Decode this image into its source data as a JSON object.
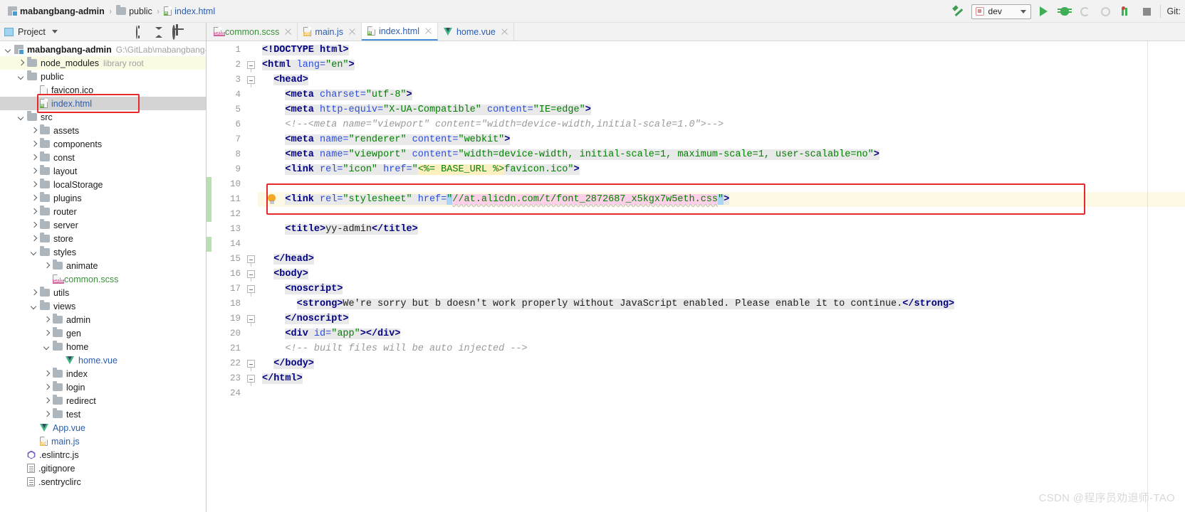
{
  "window": {
    "watermark": "CSDN @程序员劝退师-TAO"
  },
  "breadcrumb": {
    "items": [
      {
        "label": "mabangbang-admin",
        "icon": "module-icon",
        "type": "root"
      },
      {
        "label": "public",
        "icon": "folder-icon",
        "type": "folder"
      },
      {
        "label": "index.html",
        "icon": "html-file-icon",
        "type": "file"
      }
    ],
    "separator": "›"
  },
  "toolbar": {
    "build_icon": "hammer-icon",
    "run_config": {
      "label": "dev",
      "icon": "run-config-icon",
      "caret": "chevron-down-icon"
    },
    "run_icon": "run-play-icon",
    "debug_icon": "debug-bug-icon",
    "run_with_coverage_icon": "run-with-coverage-icon",
    "profile_icon": "profile-icon",
    "attach_icon": "attach-debugger-icon",
    "stop_icon": "stop-icon",
    "git_label": "Git:"
  },
  "project_panel": {
    "title": "Project",
    "title_caret": "chevron-down-icon",
    "actions": [
      {
        "name": "locate-icon"
      },
      {
        "name": "collapse-all-icon"
      },
      {
        "name": "settings-gear-icon"
      },
      {
        "name": "hide-panel-icon"
      }
    ],
    "tree": [
      {
        "depth": 0,
        "arrow": "down",
        "icon": "module",
        "label": "mabangbang-admin",
        "style": "bold",
        "note": "G:\\GitLab\\mabangbang-ad",
        "state": "normal"
      },
      {
        "depth": 1,
        "arrow": "right",
        "icon": "folder",
        "label": "node_modules",
        "style": "normal",
        "note": "library root",
        "state": "highlight"
      },
      {
        "depth": 1,
        "arrow": "down",
        "icon": "folder",
        "label": "public",
        "style": "normal",
        "note": "",
        "state": "normal"
      },
      {
        "depth": 2,
        "arrow": "none",
        "icon": "file-img",
        "label": "favicon.ico",
        "style": "normal",
        "note": "",
        "state": "normal"
      },
      {
        "depth": 2,
        "arrow": "none",
        "icon": "file-html",
        "label": "index.html",
        "style": "link",
        "note": "",
        "state": "selected"
      },
      {
        "depth": 1,
        "arrow": "down",
        "icon": "folder",
        "label": "src",
        "style": "normal",
        "note": "",
        "state": "normal"
      },
      {
        "depth": 2,
        "arrow": "right",
        "icon": "folder",
        "label": "assets",
        "style": "normal",
        "note": "",
        "state": "normal"
      },
      {
        "depth": 2,
        "arrow": "right",
        "icon": "folder",
        "label": "components",
        "style": "normal",
        "note": "",
        "state": "normal"
      },
      {
        "depth": 2,
        "arrow": "right",
        "icon": "folder",
        "label": "const",
        "style": "normal",
        "note": "",
        "state": "normal"
      },
      {
        "depth": 2,
        "arrow": "right",
        "icon": "folder",
        "label": "layout",
        "style": "normal",
        "note": "",
        "state": "normal"
      },
      {
        "depth": 2,
        "arrow": "right",
        "icon": "folder",
        "label": "localStorage",
        "style": "normal",
        "note": "",
        "state": "normal"
      },
      {
        "depth": 2,
        "arrow": "right",
        "icon": "folder",
        "label": "plugins",
        "style": "normal",
        "note": "",
        "state": "normal"
      },
      {
        "depth": 2,
        "arrow": "right",
        "icon": "folder",
        "label": "router",
        "style": "normal",
        "note": "",
        "state": "normal"
      },
      {
        "depth": 2,
        "arrow": "right",
        "icon": "folder",
        "label": "server",
        "style": "normal",
        "note": "",
        "state": "normal"
      },
      {
        "depth": 2,
        "arrow": "right",
        "icon": "folder",
        "label": "store",
        "style": "normal",
        "note": "",
        "state": "normal"
      },
      {
        "depth": 2,
        "arrow": "down",
        "icon": "folder",
        "label": "styles",
        "style": "normal",
        "note": "",
        "state": "normal"
      },
      {
        "depth": 3,
        "arrow": "right",
        "icon": "folder",
        "label": "animate",
        "style": "normal",
        "note": "",
        "state": "normal"
      },
      {
        "depth": 3,
        "arrow": "none",
        "icon": "file-sass",
        "label": "common.scss",
        "style": "scss",
        "note": "",
        "state": "normal"
      },
      {
        "depth": 2,
        "arrow": "right",
        "icon": "folder",
        "label": "utils",
        "style": "normal",
        "note": "",
        "state": "normal"
      },
      {
        "depth": 2,
        "arrow": "down",
        "icon": "folder",
        "label": "views",
        "style": "normal",
        "note": "",
        "state": "normal"
      },
      {
        "depth": 3,
        "arrow": "right",
        "icon": "folder",
        "label": "admin",
        "style": "normal",
        "note": "",
        "state": "normal"
      },
      {
        "depth": 3,
        "arrow": "right",
        "icon": "folder",
        "label": "gen",
        "style": "normal",
        "note": "",
        "state": "normal"
      },
      {
        "depth": 3,
        "arrow": "down",
        "icon": "folder",
        "label": "home",
        "style": "normal",
        "note": "",
        "state": "normal"
      },
      {
        "depth": 4,
        "arrow": "none",
        "icon": "file-vue",
        "label": "home.vue",
        "style": "vue",
        "note": "",
        "state": "normal"
      },
      {
        "depth": 3,
        "arrow": "right",
        "icon": "folder",
        "label": "index",
        "style": "normal",
        "note": "",
        "state": "normal"
      },
      {
        "depth": 3,
        "arrow": "right",
        "icon": "folder",
        "label": "login",
        "style": "normal",
        "note": "",
        "state": "normal"
      },
      {
        "depth": 3,
        "arrow": "right",
        "icon": "folder",
        "label": "redirect",
        "style": "normal",
        "note": "",
        "state": "normal"
      },
      {
        "depth": 3,
        "arrow": "right",
        "icon": "folder",
        "label": "test",
        "style": "normal",
        "note": "",
        "state": "normal"
      },
      {
        "depth": 2,
        "arrow": "none",
        "icon": "file-vue",
        "label": "App.vue",
        "style": "vue",
        "note": "",
        "state": "normal"
      },
      {
        "depth": 2,
        "arrow": "none",
        "icon": "file-js",
        "label": "main.js",
        "style": "link",
        "note": "",
        "state": "normal"
      },
      {
        "depth": 1,
        "arrow": "none",
        "icon": "file-eslint",
        "label": ".eslintrc.js",
        "style": "normal",
        "note": "",
        "state": "normal"
      },
      {
        "depth": 1,
        "arrow": "none",
        "icon": "file-plain",
        "label": ".gitignore",
        "style": "normal",
        "note": "",
        "state": "normal"
      },
      {
        "depth": 1,
        "arrow": "none",
        "icon": "file-plain",
        "label": ".sentryclirc",
        "style": "normal",
        "note": "",
        "state": "normal"
      }
    ]
  },
  "editor": {
    "tabs": [
      {
        "label": "common.scss",
        "icon": "sass-file-icon",
        "kind": "scss",
        "active": false,
        "close": "close-icon"
      },
      {
        "label": "main.js",
        "icon": "js-file-icon",
        "kind": "js",
        "active": false,
        "close": "close-icon"
      },
      {
        "label": "index.html",
        "icon": "html-file-icon",
        "kind": "html",
        "active": true,
        "close": "close-icon"
      },
      {
        "label": "home.vue",
        "icon": "vue-file-icon",
        "kind": "vue",
        "active": false,
        "close": "close-icon"
      }
    ],
    "line_numbers": [
      "1",
      "2",
      "3",
      "4",
      "5",
      "6",
      "7",
      "8",
      "9",
      "10",
      "11",
      "12",
      "13",
      "14",
      "15",
      "16",
      "17",
      "18",
      "19",
      "20",
      "21",
      "22",
      "23",
      "24"
    ],
    "highlighted_line": 11,
    "gutter_intention_icon": "lightbulb-icon",
    "annotation_color": "#e8292b",
    "code_lines": [
      {
        "n": 1,
        "indent": 0,
        "tokens": [
          {
            "t": "doctype",
            "v": "<!DOCTYPE html>"
          }
        ]
      },
      {
        "n": 2,
        "indent": 0,
        "tokens": [
          {
            "t": "tag",
            "v": "<html "
          },
          {
            "t": "attr",
            "v": "lang="
          },
          {
            "t": "val",
            "v": "\"en\""
          },
          {
            "t": "tag",
            "v": ">"
          }
        ]
      },
      {
        "n": 3,
        "indent": 1,
        "tokens": [
          {
            "t": "tag",
            "v": "<head>"
          }
        ]
      },
      {
        "n": 4,
        "indent": 2,
        "tokens": [
          {
            "t": "tag",
            "v": "<meta "
          },
          {
            "t": "attr",
            "v": "charset="
          },
          {
            "t": "val",
            "v": "\"utf-8\""
          },
          {
            "t": "tag",
            "v": ">"
          }
        ]
      },
      {
        "n": 5,
        "indent": 2,
        "tokens": [
          {
            "t": "tag",
            "v": "<meta "
          },
          {
            "t": "attr",
            "v": "http-equiv="
          },
          {
            "t": "val",
            "v": "\"X-UA-Compatible\""
          },
          {
            "t": "attr",
            "v": " content="
          },
          {
            "t": "val",
            "v": "\"IE=edge\""
          },
          {
            "t": "tag",
            "v": ">"
          }
        ]
      },
      {
        "n": 6,
        "indent": 2,
        "tokens": [
          {
            "t": "comment",
            "v": "<!--<meta name=\"viewport\" content=\"width=device-width,initial-scale=1.0\">-->"
          }
        ]
      },
      {
        "n": 7,
        "indent": 2,
        "tokens": [
          {
            "t": "tag",
            "v": "<meta "
          },
          {
            "t": "attr",
            "v": "name="
          },
          {
            "t": "val",
            "v": "\"renderer\""
          },
          {
            "t": "attr",
            "v": " content="
          },
          {
            "t": "val",
            "v": "\"webkit\""
          },
          {
            "t": "tag",
            "v": ">"
          }
        ]
      },
      {
        "n": 8,
        "indent": 2,
        "tokens": [
          {
            "t": "tag",
            "v": "<meta "
          },
          {
            "t": "attr",
            "v": "name="
          },
          {
            "t": "val",
            "v": "\"viewport\""
          },
          {
            "t": "attr",
            "v": " content="
          },
          {
            "t": "val",
            "v": "\"width=device-width, initial-scale=1, maximum-scale=1, user-scalable=no\""
          },
          {
            "t": "tag",
            "v": ">"
          }
        ]
      },
      {
        "n": 9,
        "indent": 2,
        "tokens": [
          {
            "t": "tag",
            "v": "<link "
          },
          {
            "t": "attr",
            "v": "rel="
          },
          {
            "t": "val",
            "v": "\"icon\""
          },
          {
            "t": "attr",
            "v": " href="
          },
          {
            "t": "val",
            "v": "\""
          },
          {
            "t": "tpl",
            "v": "<%= BASE_URL %>"
          },
          {
            "t": "val",
            "v": "favicon.ico\""
          },
          {
            "t": "tag",
            "v": ">"
          }
        ]
      },
      {
        "n": 10,
        "indent": 0,
        "tokens": []
      },
      {
        "n": 11,
        "indent": 2,
        "tokens": [
          {
            "t": "tag",
            "v": "<link "
          },
          {
            "t": "attr",
            "v": "rel="
          },
          {
            "t": "val",
            "v": "\"stylesheet\""
          },
          {
            "t": "attr",
            "v": " href="
          },
          {
            "t": "quotesel",
            "v": "\""
          },
          {
            "t": "urlsel",
            "v": "//at.alicdn.com/t/font_2872687_x5kgx7w5eth.css"
          },
          {
            "t": "quotesel",
            "v": "\""
          },
          {
            "t": "tag",
            "v": ">"
          }
        ]
      },
      {
        "n": 12,
        "indent": 0,
        "tokens": []
      },
      {
        "n": 13,
        "indent": 2,
        "tokens": [
          {
            "t": "tag",
            "v": "<title>"
          },
          {
            "t": "txt",
            "v": "yy-admin"
          },
          {
            "t": "tag",
            "v": "</title>"
          }
        ]
      },
      {
        "n": 14,
        "indent": 0,
        "tokens": []
      },
      {
        "n": 15,
        "indent": 1,
        "tokens": [
          {
            "t": "tag",
            "v": "</head>"
          }
        ]
      },
      {
        "n": 16,
        "indent": 1,
        "tokens": [
          {
            "t": "tag",
            "v": "<body>"
          }
        ]
      },
      {
        "n": 17,
        "indent": 2,
        "tokens": [
          {
            "t": "tag",
            "v": "<noscript>"
          }
        ]
      },
      {
        "n": 18,
        "indent": 3,
        "tokens": [
          {
            "t": "tag",
            "v": "<strong>"
          },
          {
            "t": "txt",
            "v": "We're sorry but b doesn't work properly without JavaScript enabled. Please enable it to continue."
          },
          {
            "t": "tag",
            "v": "</strong>"
          }
        ]
      },
      {
        "n": 19,
        "indent": 2,
        "tokens": [
          {
            "t": "tag",
            "v": "</noscript>"
          }
        ]
      },
      {
        "n": 20,
        "indent": 2,
        "tokens": [
          {
            "t": "tag",
            "v": "<div "
          },
          {
            "t": "attr",
            "v": "id="
          },
          {
            "t": "val",
            "v": "\"app\""
          },
          {
            "t": "tag",
            "v": "></div>"
          }
        ]
      },
      {
        "n": 21,
        "indent": 2,
        "tokens": [
          {
            "t": "comment",
            "v": "<!-- built files will be auto injected -->"
          }
        ]
      },
      {
        "n": 22,
        "indent": 1,
        "tokens": [
          {
            "t": "tag",
            "v": "</body>"
          }
        ]
      },
      {
        "n": 23,
        "indent": 0,
        "tokens": [
          {
            "t": "tag",
            "v": "</html>"
          }
        ]
      },
      {
        "n": 24,
        "indent": 0,
        "tokens": []
      }
    ]
  }
}
